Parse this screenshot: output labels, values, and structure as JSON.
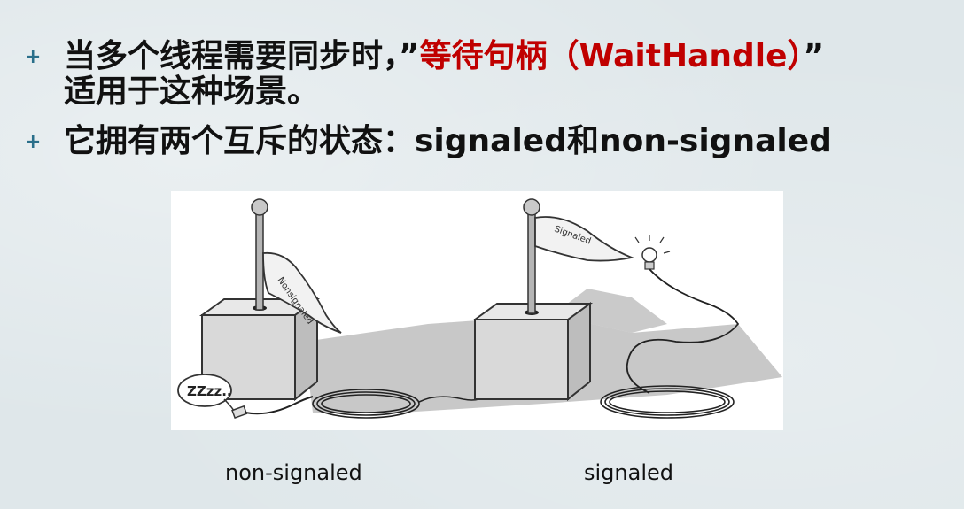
{
  "bullets": [
    {
      "line1_prefix": "当多个线程需要同步时，”",
      "line1_highlight": "等待句柄（WaitHandle）",
      "line1_suffix": "”",
      "line2": "适用于这种场景。"
    },
    {
      "line1": "它拥有两个互斥的状态：signaled和non-signaled"
    }
  ],
  "bullet_symbol": "+",
  "illustration": {
    "left_flag_text": "Nonsignaled",
    "right_flag_text": "Signaled",
    "sleep_text": "ZZzz.."
  },
  "captions": {
    "left": "non-signaled",
    "right": "signaled"
  },
  "colors": {
    "highlight": "#c00000",
    "bullet": "#2a6f8a"
  }
}
